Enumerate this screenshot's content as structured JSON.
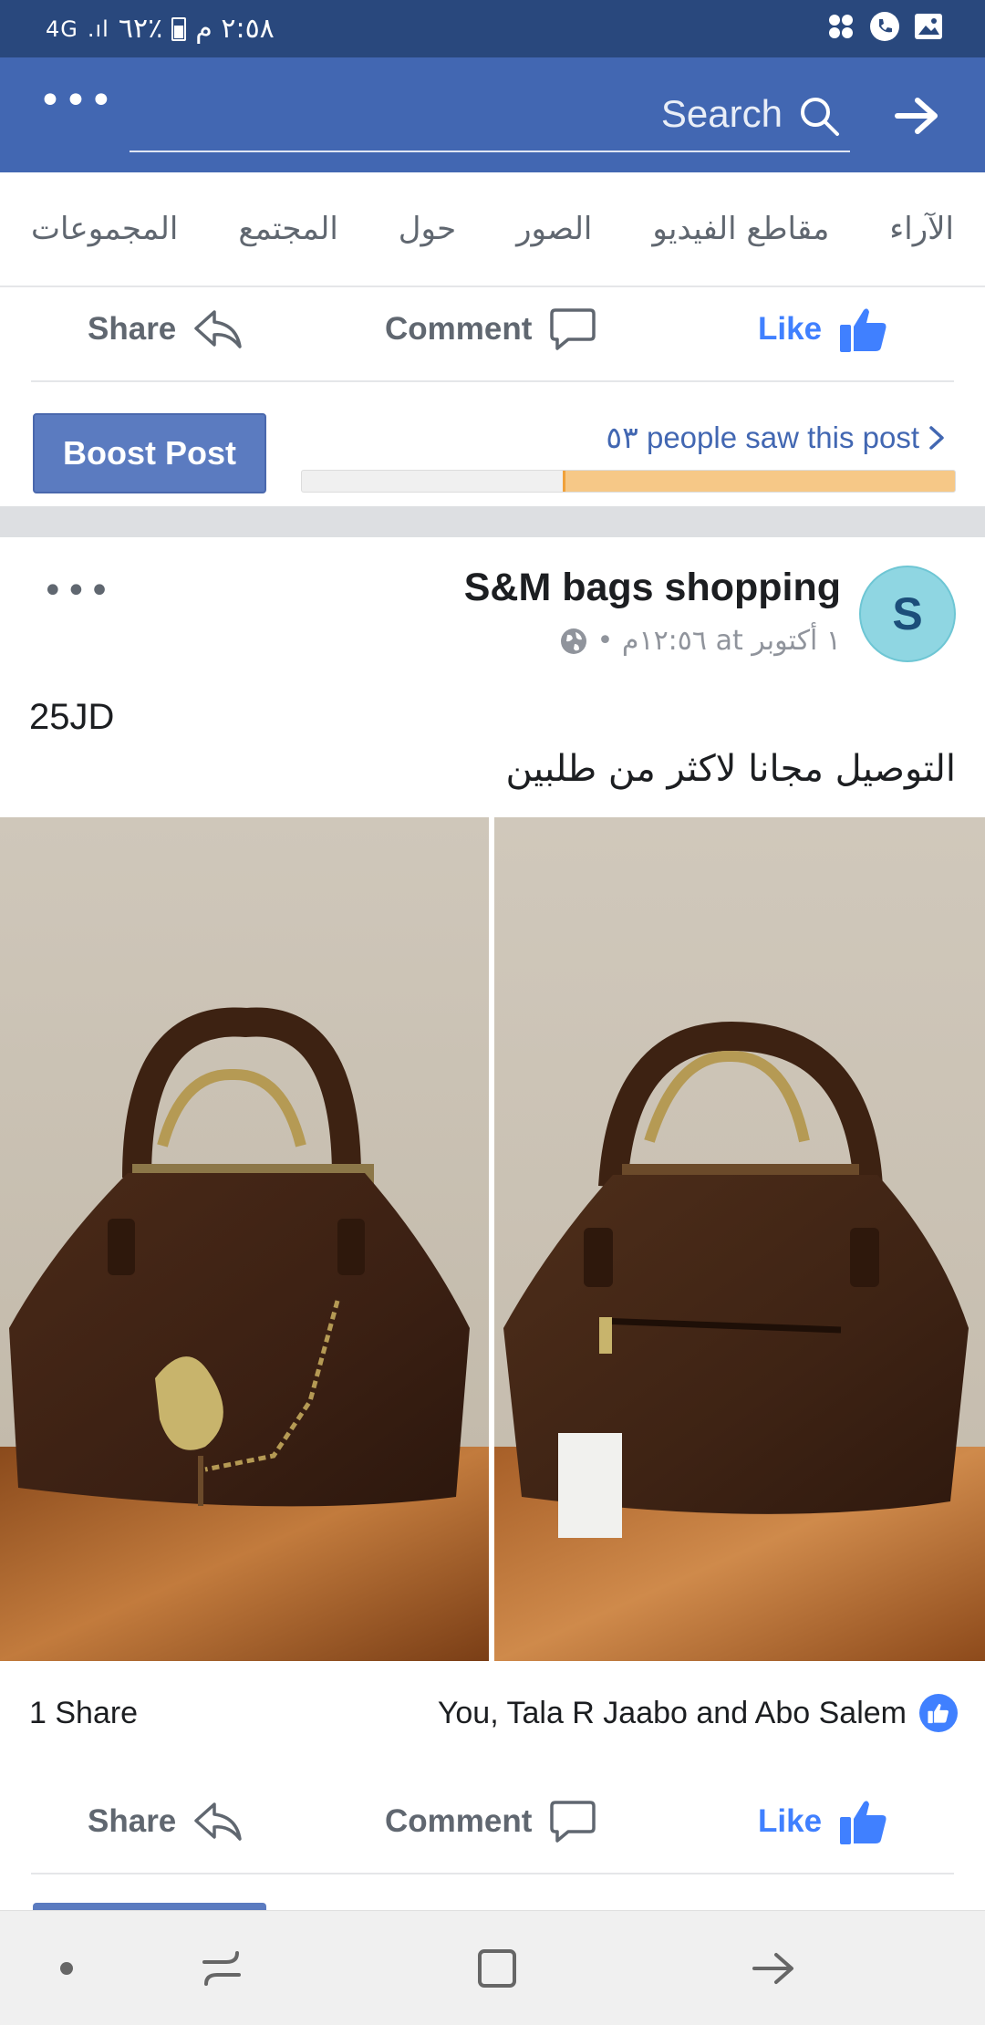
{
  "status_bar": {
    "time": "٢:٥٨ م",
    "battery": "٪٦٢",
    "signal": "4G"
  },
  "header": {
    "search_label": "Search"
  },
  "tabs": [
    "الآراء",
    "مقاطع الفيديو",
    "الصور",
    "حول",
    "المجتمع",
    "المجموعات"
  ],
  "actions": {
    "share": "Share",
    "comment": "Comment",
    "like": "Like"
  },
  "boost": {
    "button": "Boost Post",
    "reach_text": "٥٣ people saw this post",
    "progress_fraction": 0.6
  },
  "post": {
    "page_name": "S&M bags shopping",
    "avatar_letter": "S",
    "meta": "١ أكتوبر at ١٢:٥٦م •",
    "text_line1": "25JD",
    "text_line2": "التوصيل مجانا لاكثر من طلبين",
    "shares": "1 Share",
    "reactions": "You, Tala R Jaabo and Abo Salem"
  },
  "colors": {
    "status_bar": "#29487d",
    "header": "#4267b2",
    "like_blue": "#4080ff",
    "progress_fill": "#f6c887"
  }
}
